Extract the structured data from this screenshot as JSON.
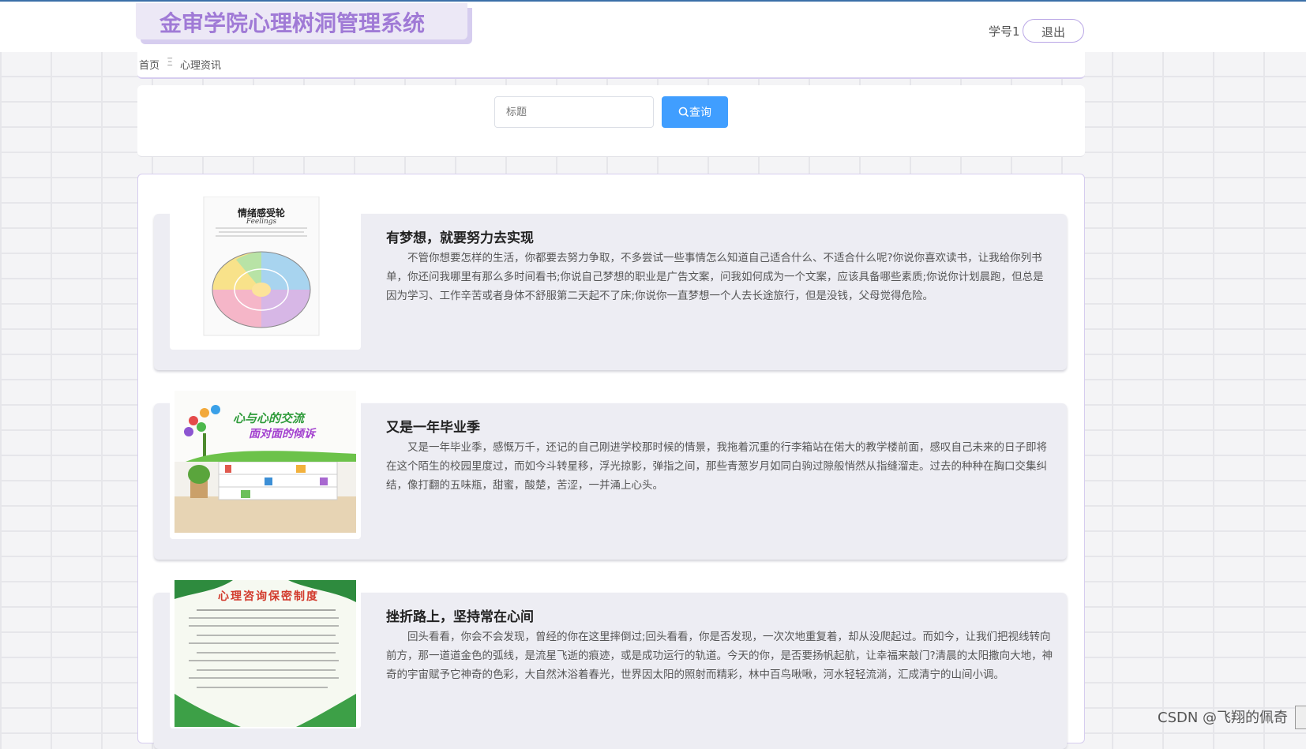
{
  "header": {
    "app_title": "金审学院心理树洞管理系统",
    "user_label": "学号1",
    "logout_label": "退出"
  },
  "breadcrumb": {
    "home": "首页",
    "separator": "Ξ",
    "current": "心理资讯"
  },
  "search": {
    "placeholder": "标题",
    "button_label": "查询",
    "button_icon": "search-icon"
  },
  "news": [
    {
      "title": "有梦想，就要努力去实现",
      "body": "不管你想要怎样的生活，你都要去努力争取，不多尝试一些事情怎么知道自己适合什么、不适合什么呢?你说你喜欢读书，让我给你列书单，你还问我哪里有那么多时间看书;你说自己梦想的职业是广告文案，问我如何成为一个文案，应该具备哪些素质;你说你计划晨跑，但总是因为学习、工作辛苦或者身体不舒服第二天起不了床;你说你一直梦想一个人去长途旅行，但是没钱，父母觉得危险。",
      "image": {
        "heading": "情绪感受轮",
        "subheading": "Feelings"
      }
    },
    {
      "title": "又是一年毕业季",
      "body": "又是一年毕业季，感慨万千，还记的自己刚进学校那时候的情景，我拖着沉重的行李箱站在偌大的教学楼前面，感叹自己未来的日子即将在这个陌生的校园里度过，而如今斗转星移，浮光掠影，弹指之间，那些青葱岁月如同白驹过隙般悄然从指缝溜走。过去的种种在胸口交集纠结，像打翻的五味瓶，甜蜜，酸楚，苦涩，一并涌上心头。",
      "image": {
        "line1": "心与心的交流",
        "line2": "面对面的倾诉"
      }
    },
    {
      "title": "挫折路上，坚持常在心间",
      "body": "回头看看，你会不会发现，曾经的你在这里摔倒过;回头看看，你是否发现，一次次地重复着，却从没爬起过。而如今，让我们把视线转向前方，那一道道金色的弧线，是流星飞逝的痕迹，或是成功运行的轨道。今天的你，是否要扬帆起航，让幸福来敲门?清晨的太阳撒向大地，神奇的宇宙赋予它神奇的色彩，大自然沐浴着春光，世界因太阳的照射而精彩，林中百鸟啾啾，河水轻轻流淌，汇成清宁的山间小调。",
      "image": {
        "heading": "心理咨询保密制度"
      }
    }
  ],
  "watermark": "CSDN @飞翔的佩奇",
  "colors": {
    "accent": "#a07ad6",
    "button": "#409eff",
    "card_bg": "#ededf3"
  }
}
